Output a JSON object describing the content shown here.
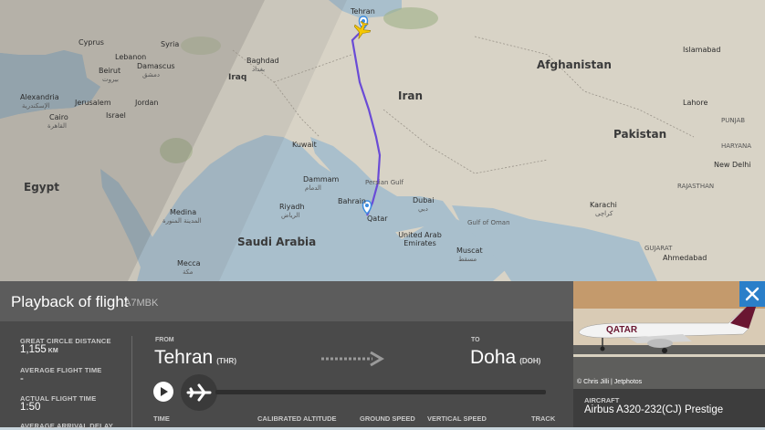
{
  "map": {
    "countries": {
      "egypt": "Egypt",
      "saudi_arabia": "Saudi Arabia",
      "iran": "Iran",
      "iraq": "Iraq",
      "afghanistan": "Afghanistan",
      "pakistan": "Pakistan",
      "syria": "Syria",
      "jordan": "Jordan",
      "kuwait": "Kuwait",
      "lebanon": "Lebanon",
      "cyprus": "Cyprus",
      "israel": "Israel",
      "bahrain": "Bahrain",
      "qatar": "Qatar",
      "uae": "United Arab Emirates"
    },
    "cities": {
      "tehran": "Tehran",
      "beirut": "Beirut",
      "beirut_ar": "بيروت",
      "damascus": "Damascus",
      "damascus_ar": "دمشق",
      "baghdad": "Baghdad",
      "baghdad_ar": "بغداد",
      "alexandria": "Alexandria",
      "alexandria_ar": "الإسكندرية",
      "jerusalem": "Jerusalem",
      "cairo": "Cairo",
      "cairo_ar": "القاهرة",
      "dammam": "Dammam",
      "dammam_ar": "الدمام",
      "riyadh": "Riyadh",
      "riyadh_ar": "الرياض",
      "medina": "Medina",
      "medina_ar": "المدينة المنورة",
      "mecca": "Mecca",
      "mecca_ar": "مكة",
      "doha": "Doha",
      "dubai": "Dubai",
      "dubai_ar": "دبي",
      "muscat": "Muscat",
      "muscat_ar": "مسقط",
      "karachi": "Karachi",
      "karachi_ar": "کراچی",
      "lahore": "Lahore",
      "islamabad": "Islamabad",
      "new_delhi": "New Delhi",
      "ahmedabad": "Ahmedabad",
      "haryana": "HARYANA",
      "rajasthan": "RAJASTHAN",
      "gujarat": "GUJARAT",
      "punjab": "PUNJAB",
      "persian_gulf": "Persian Gulf",
      "gulf_of_oman": "Gulf of Oman"
    },
    "colors": {
      "water": "#a9bfcc",
      "land": "#d8d3c6",
      "route": "#6a4bd6"
    }
  },
  "panel": {
    "title": "Playback of flight",
    "registration": "A7MBK",
    "stats": {
      "gc_distance_label": "GREAT CIRCLE DISTANCE",
      "gc_distance_value": "1,155",
      "gc_distance_unit": "KM",
      "avg_time_label": "AVERAGE FLIGHT TIME",
      "avg_time_value": "-",
      "actual_time_label": "ACTUAL FLIGHT TIME",
      "actual_time_value": "1:50",
      "avg_arrival_delay_label": "AVERAGE ARRIVAL DELAY"
    },
    "from_label": "FROM",
    "from_city": "Tehran",
    "from_code": "(THR)",
    "to_label": "TO",
    "to_city": "Doha",
    "to_code": "(DOH)",
    "columns": {
      "time": "TIME",
      "calibrated_altitude": "CALIBRATED ALTITUDE",
      "ground_speed": "GROUND SPEED",
      "vertical_speed": "VERTICAL SPEED",
      "track": "TRACK"
    }
  },
  "photo": {
    "credit": "© Chris Jilli | Jetphotos",
    "livery_text": "QATAR"
  },
  "aircraft": {
    "label": "AIRCRAFT",
    "type": "Airbus A320-232(CJ) Prestige"
  }
}
